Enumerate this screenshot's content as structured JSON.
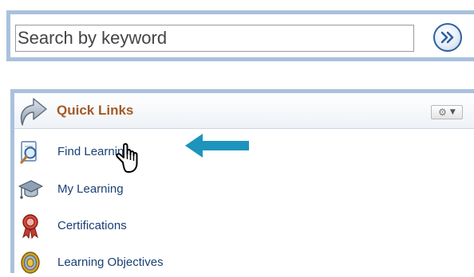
{
  "search": {
    "placeholder": "Search by keyword",
    "value": "",
    "go_icon": "double-chevron-right-icon"
  },
  "quick_links": {
    "header_icon": "curved-arrow-icon",
    "title": "Quick Links",
    "menu_icon": "gear-icon",
    "menu_caret_icon": "caret-down-icon",
    "items": [
      {
        "label": "Find Learning",
        "icon": "magnifier-document-icon"
      },
      {
        "label": "My Learning",
        "icon": "graduation-cap-icon"
      },
      {
        "label": "Certifications",
        "icon": "ribbon-award-icon"
      },
      {
        "label": "Learning Objectives",
        "icon": "target-icon"
      }
    ]
  },
  "overlays": {
    "callout_arrow": "left-arrow-icon",
    "cursor": "hand-pointer-icon"
  },
  "colors": {
    "panel_border": "#a9c1de",
    "title_text": "#a45a25",
    "link_text": "#1a3f74",
    "callout_arrow": "#1c94bc",
    "go_button_border": "#2f5f9f"
  }
}
